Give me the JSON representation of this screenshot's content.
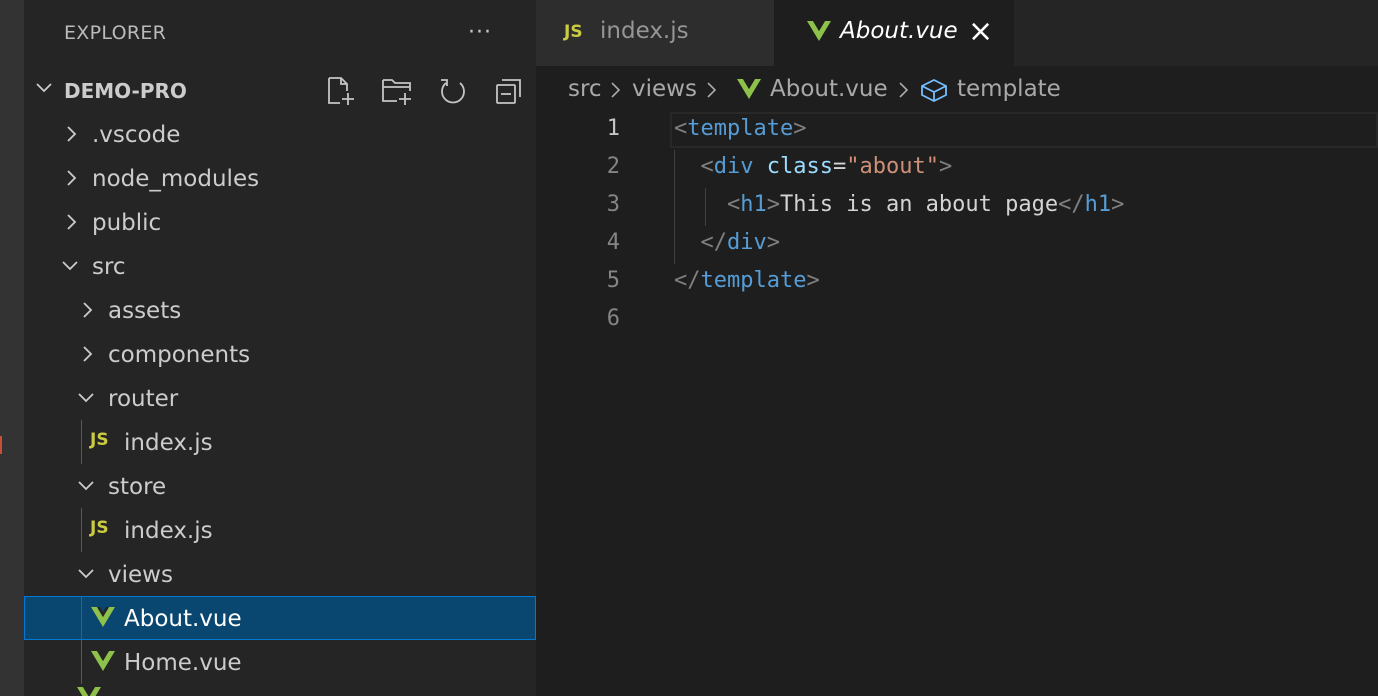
{
  "explorer": {
    "title": "EXPLORER",
    "more_label": "···",
    "project": "DEMO-PRO",
    "actions": [
      "new-file-icon",
      "new-folder-icon",
      "refresh-icon",
      "collapse-all-icon"
    ],
    "tree": [
      {
        "label": ".vscode",
        "type": "folder",
        "expanded": false
      },
      {
        "label": "node_modules",
        "type": "folder",
        "expanded": false
      },
      {
        "label": "public",
        "type": "folder",
        "expanded": false
      },
      {
        "label": "src",
        "type": "folder",
        "expanded": true
      },
      {
        "label": "assets",
        "type": "folder",
        "expanded": false
      },
      {
        "label": "components",
        "type": "folder",
        "expanded": false
      },
      {
        "label": "router",
        "type": "folder",
        "expanded": true
      },
      {
        "label": "index.js",
        "type": "js",
        "badge": "JS"
      },
      {
        "label": "store",
        "type": "folder",
        "expanded": true
      },
      {
        "label": "index.js",
        "type": "js",
        "badge": "JS"
      },
      {
        "label": "views",
        "type": "folder",
        "expanded": true
      },
      {
        "label": "About.vue",
        "type": "vue",
        "selected": true
      },
      {
        "label": "Home.vue",
        "type": "vue"
      }
    ]
  },
  "tabs": [
    {
      "label": "index.js",
      "badge": "JS",
      "active": false
    },
    {
      "label": "About.vue",
      "active": true,
      "close": "×"
    }
  ],
  "breadcrumb": [
    "src",
    "views",
    "About.vue",
    "template"
  ],
  "code": {
    "line_numbers": [
      "1",
      "2",
      "3",
      "4",
      "5",
      "6"
    ],
    "lines": [
      [
        {
          "t": "<",
          "c": "punct"
        },
        {
          "t": "template",
          "c": "tag"
        },
        {
          "t": ">",
          "c": "punct"
        }
      ],
      [
        {
          "t": "  ",
          "c": "text"
        },
        {
          "t": "<",
          "c": "punct"
        },
        {
          "t": "div",
          "c": "tag"
        },
        {
          "t": " ",
          "c": "text"
        },
        {
          "t": "class",
          "c": "attr"
        },
        {
          "t": "=",
          "c": "text"
        },
        {
          "t": "\"about\"",
          "c": "str"
        },
        {
          "t": ">",
          "c": "punct"
        }
      ],
      [
        {
          "t": "    ",
          "c": "text"
        },
        {
          "t": "<",
          "c": "punct"
        },
        {
          "t": "h1",
          "c": "tag"
        },
        {
          "t": ">",
          "c": "punct"
        },
        {
          "t": "This is an about page",
          "c": "text"
        },
        {
          "t": "</",
          "c": "punct"
        },
        {
          "t": "h1",
          "c": "tag"
        },
        {
          "t": ">",
          "c": "punct"
        }
      ],
      [
        {
          "t": "  ",
          "c": "text"
        },
        {
          "t": "</",
          "c": "punct"
        },
        {
          "t": "div",
          "c": "tag"
        },
        {
          "t": ">",
          "c": "punct"
        }
      ],
      [
        {
          "t": "</",
          "c": "punct"
        },
        {
          "t": "template",
          "c": "tag"
        },
        {
          "t": ">",
          "c": "punct"
        }
      ],
      []
    ]
  },
  "colors": {
    "sidebar_bg": "#252526",
    "editor_bg": "#1e1e1e",
    "selection_bg": "#094771",
    "vue_green": "#8dc149",
    "js_yellow": "#cbcb41",
    "tag_blue": "#569cd6",
    "attr_blue": "#9cdcfe",
    "string_orange": "#ce9178"
  }
}
